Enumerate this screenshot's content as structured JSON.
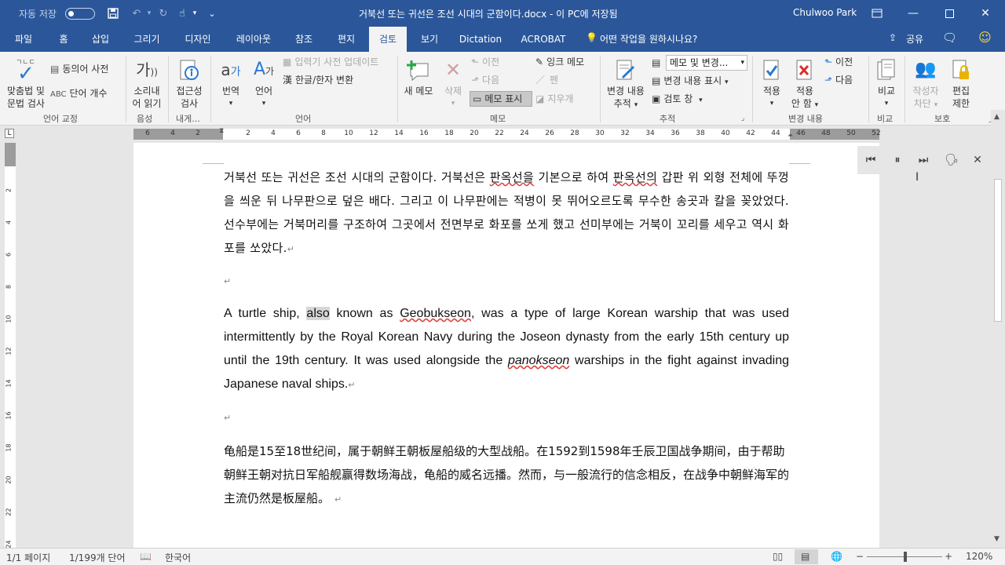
{
  "titlebar": {
    "autosave_label": "자동 저장",
    "autosave_state": "끔",
    "doc_title": "거북선 또는 귀선은 조선 시대의 군함이다.docx - 이 PC에 저장됨",
    "user_name": "Chulwoo Park"
  },
  "menu_tabs": [
    "파일",
    "홈",
    "삽입",
    "그리기",
    "디자인",
    "레이아웃",
    "참조",
    "편지",
    "검토",
    "보기",
    "Dictation",
    "ACROBAT"
  ],
  "active_tab": "검토",
  "tell_me": "어떤 작업을 원하시나요?",
  "share_label": "공유",
  "ribbon": {
    "proofing": {
      "spelling_label_1": "맞춤법 및",
      "spelling_label_2": "문법 검사",
      "thesaurus": "동의어 사전",
      "word_count": "단어 개수",
      "group": "언어 교정"
    },
    "speech": {
      "read_aloud_1": "소리내",
      "read_aloud_2": "어 읽기",
      "group": "음성"
    },
    "accessibility": {
      "check_1": "접근성",
      "check_2": "검사",
      "group": "내게..."
    },
    "language": {
      "translate": "번역",
      "language": "언어",
      "update_ime": "입력기 사전 업데이트",
      "hanja": "한글/한자 변환",
      "group": "언어"
    },
    "comments": {
      "new_comment": "새 메모",
      "delete": "삭제",
      "previous": "이전",
      "next": "다음",
      "show_comments": "메모 표시",
      "ink_comment": "잉크 메모",
      "pen": "펜",
      "eraser": "지우개",
      "group": "메모"
    },
    "tracking": {
      "track_changes_1": "변경 내용",
      "track_changes_2": "추적",
      "markup_combo": "메모 및 변경...",
      "show_markup": "변경 내용 표시",
      "review_pane": "검토 창",
      "group": "추적"
    },
    "changes": {
      "accept": "적용",
      "reject_1": "적용",
      "reject_2": "안 함",
      "previous": "이전",
      "next": "다음",
      "group": "변경 내용"
    },
    "compare": {
      "compare": "비교",
      "group": "비교"
    },
    "protect": {
      "block_authors_1": "작성자",
      "block_authors_2": "차단",
      "restrict_editing_1": "편집",
      "restrict_editing_2": "제한",
      "group": "보호"
    }
  },
  "ruler_numbers": [
    "6",
    "4",
    "2",
    "",
    "2",
    "4",
    "6",
    "8",
    "10",
    "12",
    "14",
    "16",
    "18",
    "20",
    "22",
    "24",
    "26",
    "28",
    "30",
    "32",
    "34",
    "36",
    "38",
    "40",
    "42",
    "44",
    "46",
    "48",
    "50",
    "52"
  ],
  "vruler_numbers": [
    "2",
    "4",
    "6",
    "8",
    "10",
    "12",
    "14",
    "16",
    "18",
    "20",
    "22",
    "24"
  ],
  "document": {
    "korean": {
      "s1": "거북선 또는 귀선은 조선 시대의 군함이다. 거북선은 ",
      "w1": "판옥선을",
      "s2": " 기본으로 하여 ",
      "w2": "판옥선의",
      "s3": " 갑판 위 외형 전체에 뚜껑을 씌운 뒤 나무판으로 덮은 배다. 그리고 이 나무판에는 적병이 못 뛰어오르도록 무수한 송곳과 칼을 꽂았었다. 선수부에는 거북머리를 구조하여 그곳에서 전면부로 화포를 쏘게 했고 선미부에는 거북이 꼬리를 세우고 역시 화포를 쏘았다."
    },
    "english": {
      "s1": "A turtle ship, ",
      "highlight": "also",
      "s2": " known as ",
      "w1": "Geobukseon",
      "s3": ", was a type of large Korean warship that was used intermittently by the Royal Korean Navy during the Joseon dynasty from the early 15th century up until the 19th century. It was used alongside the ",
      "w2": "panokseon",
      "s4": " warships in the fight against invading Japanese naval ships."
    },
    "chinese": "龟船是15至18世纪间，属于朝鲜王朝板屋船级的大型战船。在1592到1598年壬辰卫国战争期间，由于帮助朝鲜王朝对抗日军船舰赢得数场海战，龟船的威名远播。然而，与一般流行的信念相反，在战争中朝鲜海军的主流仍然是板屋船。",
    "para_mark": "↵"
  },
  "statusbar": {
    "page": "1/1 페이지",
    "words": "1/199개 단어",
    "language": "한국어",
    "zoom": "120%"
  }
}
